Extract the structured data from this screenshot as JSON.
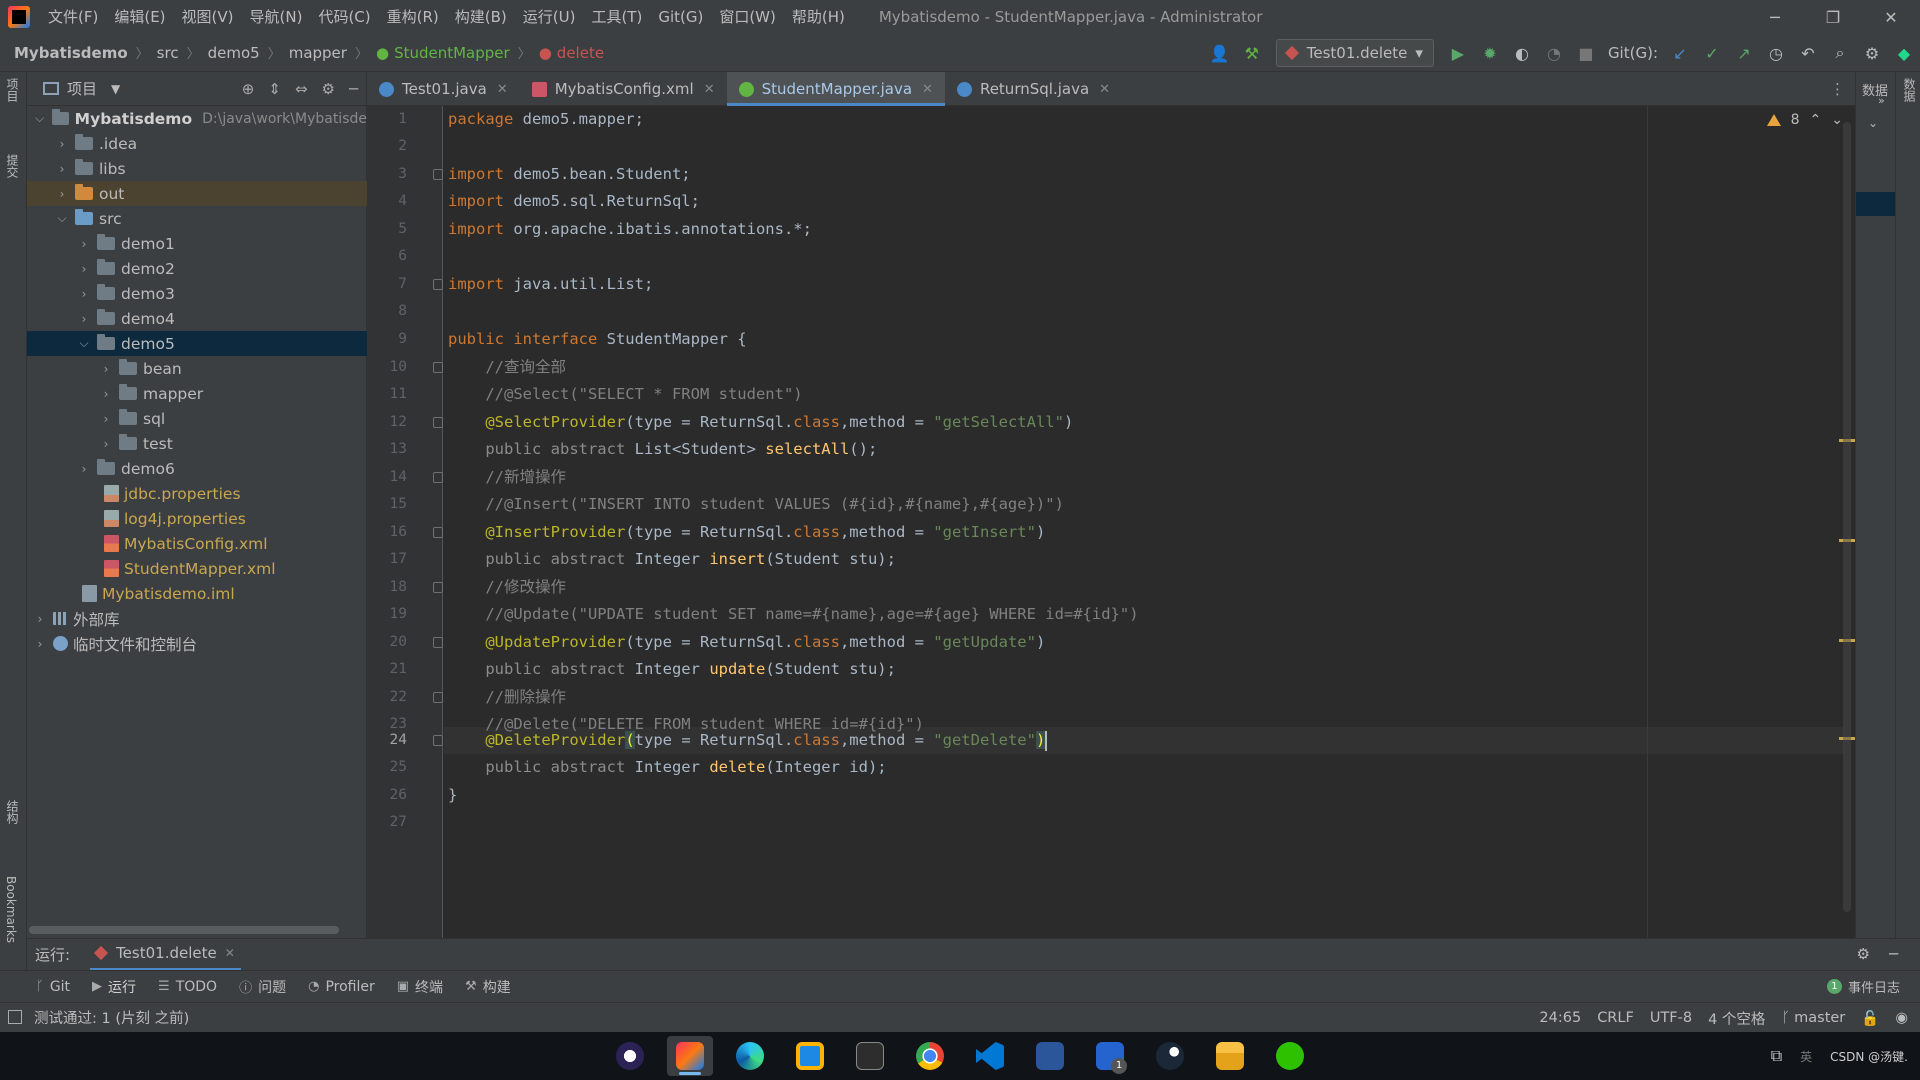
{
  "menu": {
    "items": [
      "文件(F)",
      "编辑(E)",
      "视图(V)",
      "导航(N)",
      "代码(C)",
      "重构(R)",
      "构建(B)",
      "运行(U)",
      "工具(T)",
      "Git(G)",
      "窗口(W)",
      "帮助(H)"
    ],
    "window_title": "Mybatisdemo - StudentMapper.java - Administrator"
  },
  "breadcrumb": {
    "project": "Mybatisdemo",
    "p1": "src",
    "p2": "demo5",
    "p3": "mapper",
    "class": "StudentMapper",
    "method": "delete"
  },
  "toolbar": {
    "run_config": "Test01.delete",
    "git_label": "Git(G):"
  },
  "sidebar": {
    "project_tab": "项目",
    "commit_tab": "提交",
    "structure_tab": "结构",
    "bookmarks_tab": "Bookmarks"
  },
  "project_panel": {
    "title": "项目",
    "root_name": "Mybatisdemo",
    "root_path": "D:\\java\\work\\Mybatisde",
    "nodes": [
      ".idea",
      "libs",
      "out",
      "src",
      "demo1",
      "demo2",
      "demo3",
      "demo4",
      "demo5",
      "bean",
      "mapper",
      "sql",
      "test",
      "demo6",
      "jdbc.properties",
      "log4j.properties",
      "MybatisConfig.xml",
      "StudentMapper.xml",
      "Mybatisdemo.iml",
      "外部库",
      "临时文件和控制台"
    ]
  },
  "tabs": [
    "Test01.java",
    "MybatisConfig.xml",
    "StudentMapper.java",
    "ReturnSql.java"
  ],
  "editor": {
    "warning_count": "8",
    "line_numbers": [
      "1",
      "2",
      "3",
      "4",
      "5",
      "6",
      "7",
      "8",
      "9",
      "10",
      "11",
      "12",
      "13",
      "14",
      "15",
      "16",
      "17",
      "18",
      "19",
      "20",
      "21",
      "22",
      "23",
      "24",
      "25",
      "26",
      "27"
    ],
    "code": {
      "l1_kw": "package",
      "l1_rest": " demo5.mapper;",
      "l3_kw": "import",
      "l3_rest": " demo5.bean.Student;",
      "l4_kw": "import",
      "l4_rest": " demo5.sql.ReturnSql;",
      "l5_kw": "import",
      "l5_rest": " org.apache.ibatis.annotations.*;",
      "l7_kw": "import",
      "l7_rest": " java.util.List;",
      "l9_kw": "public interface",
      "l9_rest": " StudentMapper {",
      "l10": "    //查询全部",
      "l11": "    //@Select(\"SELECT * FROM student\")",
      "l12_ann": "@SelectProvider",
      "l12_a": "(type = ReturnSql.",
      "l12_kw": "class",
      "l12_b": ",method = ",
      "l12_str": "\"getSelectAll\"",
      "l12_c": ")",
      "l13_kw": "public abstract",
      "l13_a": " List<Student> ",
      "l13_fn": "selectAll",
      "l13_b": "();",
      "l14": "    //新增操作",
      "l15": "    //@Insert(\"INSERT INTO student VALUES (#{id},#{name},#{age})\")",
      "l16_ann": "@InsertProvider",
      "l16_a": "(type = ReturnSql.",
      "l16_kw": "class",
      "l16_b": ",method = ",
      "l16_str": "\"getInsert\"",
      "l16_c": ")",
      "l17_kw": "public abstract",
      "l17_a": " Integer ",
      "l17_fn": "insert",
      "l17_b": "(Student stu);",
      "l18": "    //修改操作",
      "l19": "    //@Update(\"UPDATE student SET name=#{name},age=#{age} WHERE id=#{id}\")",
      "l20_ann": "@UpdateProvider",
      "l20_a": "(type = ReturnSql.",
      "l20_kw": "class",
      "l20_b": ",method = ",
      "l20_str": "\"getUpdate\"",
      "l20_c": ")",
      "l21_kw": "public abstract",
      "l21_a": " Integer ",
      "l21_fn": "update",
      "l21_b": "(Student stu);",
      "l22": "    //删除操作",
      "l23": "    //@Delete(\"DELETE FROM student WHERE id=#{id}\")",
      "l24_ann": "@DeleteProvider",
      "l24_p": "(",
      "l24_a": "type = ReturnSql.",
      "l24_kw": "class",
      "l24_b": ",method = ",
      "l24_str": "\"getDelete\"",
      "l24_c": ")",
      "l25_kw": "public abstract",
      "l25_a": " Integer ",
      "l25_fn": "delete",
      "l25_b": "(Integer id);",
      "l26": "}"
    }
  },
  "right_panel": {
    "db_label": "数据"
  },
  "run_panel": {
    "label": "运行:",
    "tab": "Test01.delete"
  },
  "tool_windows": [
    "Git",
    "运行",
    "TODO",
    "问题",
    "Profiler",
    "终端",
    "构建"
  ],
  "event_log": "事件日志",
  "status": {
    "message": "测试通过: 1 (片刻 之前)",
    "position": "24:65",
    "line_sep": "CRLF",
    "encoding": "UTF-8",
    "indent": "4 个空格",
    "branch": "master"
  },
  "taskbar": {
    "tray_text": "CSDN @汤键.",
    "badge": "1"
  },
  "colors": {
    "accent": "#4a88c7",
    "editor_bg": "#2b2b2b",
    "panel_bg": "#3c3f41"
  }
}
